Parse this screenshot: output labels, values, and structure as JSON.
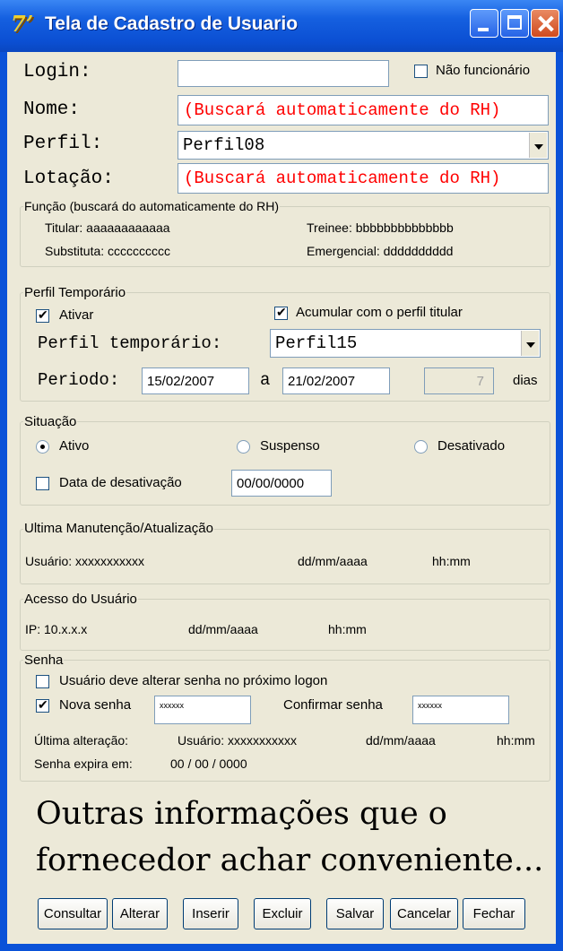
{
  "window": {
    "title": "Tela de Cadastro de Usuario"
  },
  "form": {
    "login_label": "Login:",
    "login_value": "",
    "nao_funcionario_label": "Não funcionário",
    "nao_funcionario_checked": false,
    "nome_label": "Nome:",
    "nome_value": "(Buscará automaticamente do RH)",
    "perfil_label": "Perfil:",
    "perfil_value": "Perfil08",
    "lotacao_label": "Lotação:",
    "lotacao_value": "(Buscará automaticamente do RH)"
  },
  "funcao": {
    "legend": "Função (buscará do automaticamente do RH)",
    "titular": "Titular:  aaaaaaaaaaaa",
    "trainee": "Treinee: bbbbbbbbbbbbbb",
    "substituta": "Substituta: cccccccccc",
    "emergencial": "Emergencial: dddddddddd"
  },
  "perfil_temporario": {
    "legend": "Perfil Temporário",
    "ativar_label": "Ativar",
    "ativar_checked": true,
    "acumular_label": "Acumular com o perfil titular",
    "acumular_checked": true,
    "perfil_label": "Perfil temporário:",
    "perfil_value": "Perfil15",
    "periodo_label": "Periodo:",
    "data_inicio": "15/02/2007",
    "a_label": "a",
    "data_fim": "21/02/2007",
    "dias_value": "7",
    "dias_label": "dias"
  },
  "situacao": {
    "legend": "Situação",
    "ativo_label": "Ativo",
    "suspenso_label": "Suspenso",
    "desativado_label": "Desativado",
    "selected": "Ativo",
    "data_desativacao_label": "Data de desativação",
    "data_desativacao_checked": false,
    "data_desativacao_value": "00/00/0000"
  },
  "manutencao": {
    "legend": "Ultima Manutenção/Atualização",
    "usuario": "Usuário:  xxxxxxxxxxx",
    "data": "dd/mm/aaaa",
    "hora": "hh:mm"
  },
  "acesso": {
    "legend": "Acesso do Usuário",
    "ip": "IP: 10.x.x.x",
    "data": "dd/mm/aaaa",
    "hora": "hh:mm"
  },
  "senha": {
    "legend": "Senha",
    "alterar_label": "Usuário deve alterar senha no próximo logon",
    "alterar_checked": false,
    "nova_senha_label": "Nova senha",
    "nova_senha_checked": true,
    "nova_senha_value": "xxxxxx",
    "confirmar_label": "Confirmar senha",
    "confirmar_value": "xxxxxx",
    "ultima_alteracao_label": "Última alteração:",
    "ultima_usuario": "Usuário:  xxxxxxxxxxx",
    "ultima_data": "dd/mm/aaaa",
    "ultima_hora": "hh:mm",
    "expira_label": "Senha expira em:",
    "expira_value": "00 / 00 / 0000"
  },
  "nota": {
    "line1": "Outras informações que o",
    "line2": "fornecedor achar conveniente..."
  },
  "buttons": {
    "consultar": "Consultar",
    "alterar": "Alterar",
    "inserir": "Inserir",
    "excluir": "Excluir",
    "salvar": "Salvar",
    "cancelar": "Cancelar",
    "fechar": "Fechar"
  }
}
